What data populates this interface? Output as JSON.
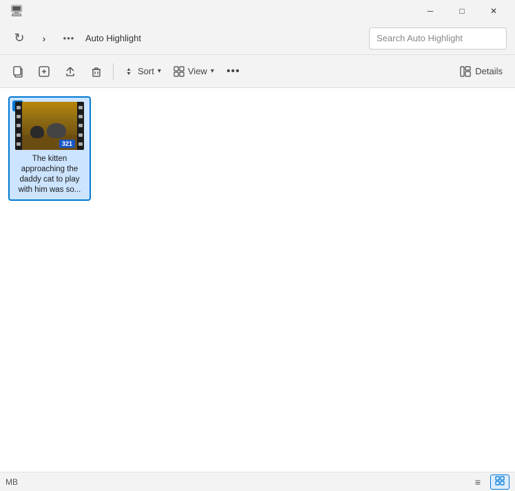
{
  "titlebar": {
    "close_label": "✕",
    "minimize_label": "─",
    "maximize_label": "□",
    "tab_add_label": "+"
  },
  "addressbar": {
    "back_icon": "›",
    "more_icon": "•••",
    "title": "Auto Highlight",
    "search_placeholder": "Search Auto Highlight"
  },
  "toolbar": {
    "copy_icon": "⧉",
    "highlight_icon": "⊡",
    "share_icon": "↗",
    "delete_icon": "🗑",
    "sort_label": "Sort",
    "sort_icon": "↕",
    "view_label": "View",
    "view_icon": "⊟",
    "more_icon": "•••",
    "details_icon": "⊞",
    "details_label": "Details"
  },
  "file": {
    "name": "The kitten approaching the daddy cat to play with him was so...",
    "badge": "321"
  },
  "statusbar": {
    "info": "MB",
    "list_icon": "≡",
    "grid_icon": "⊟"
  }
}
